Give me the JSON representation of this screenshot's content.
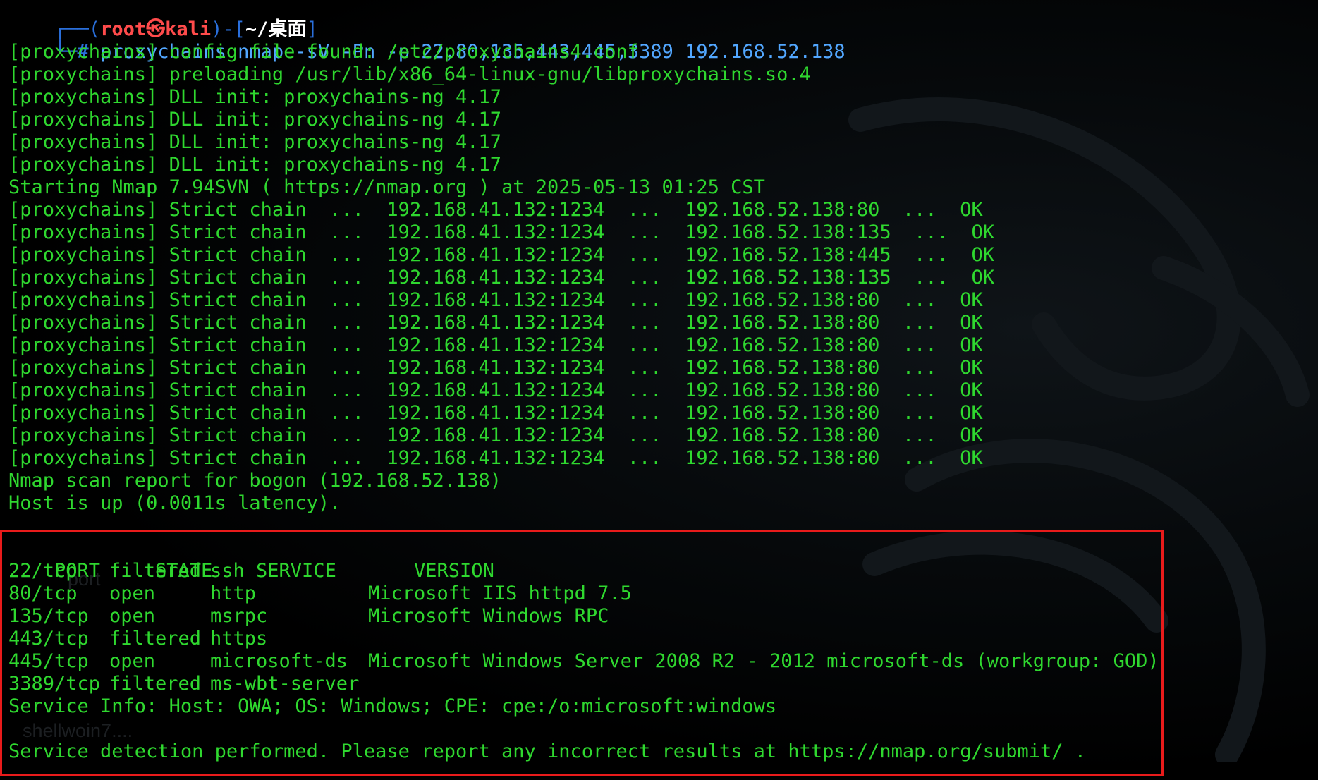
{
  "prompt": {
    "frame_open": "┌──(",
    "user": "root㉿kali",
    "frame_mid": ")-[",
    "dir": "~/桌面",
    "frame_close": "]",
    "hash_prefix": "└─",
    "hash": "#",
    "command": " proxychains nmap -sV -Pn -p 22,80,135,443,445,3389 192.168.52.138"
  },
  "output_lines": [
    "[proxychains] config file found: /etc/proxychains4.conf",
    "[proxychains] preloading /usr/lib/x86_64-linux-gnu/libproxychains.so.4",
    "[proxychains] DLL init: proxychains-ng 4.17",
    "[proxychains] DLL init: proxychains-ng 4.17",
    "[proxychains] DLL init: proxychains-ng 4.17",
    "[proxychains] DLL init: proxychains-ng 4.17",
    "Starting Nmap 7.94SVN ( https://nmap.org ) at 2025-05-13 01:25 CST",
    "[proxychains] Strict chain  ...  192.168.41.132:1234  ...  192.168.52.138:80  ...  OK",
    "[proxychains] Strict chain  ...  192.168.41.132:1234  ...  192.168.52.138:135  ...  OK",
    "[proxychains] Strict chain  ...  192.168.41.132:1234  ...  192.168.52.138:445  ...  OK",
    "[proxychains] Strict chain  ...  192.168.41.132:1234  ...  192.168.52.138:135  ...  OK",
    "[proxychains] Strict chain  ...  192.168.41.132:1234  ...  192.168.52.138:80  ...  OK",
    "[proxychains] Strict chain  ...  192.168.41.132:1234  ...  192.168.52.138:80  ...  OK",
    "[proxychains] Strict chain  ...  192.168.41.132:1234  ...  192.168.52.138:80  ...  OK",
    "[proxychains] Strict chain  ...  192.168.41.132:1234  ...  192.168.52.138:80  ...  OK",
    "[proxychains] Strict chain  ...  192.168.41.132:1234  ...  192.168.52.138:80  ...  OK",
    "[proxychains] Strict chain  ...  192.168.41.132:1234  ...  192.168.52.138:80  ...  OK",
    "[proxychains] Strict chain  ...  192.168.41.132:1234  ...  192.168.52.138:80  ...  OK",
    "[proxychains] Strict chain  ...  192.168.41.132:1234  ...  192.168.52.138:80  ...  OK",
    "Nmap scan report for bogon (192.168.52.138)",
    "Host is up (0.0011s latency)."
  ],
  "port_table": {
    "headers": [
      "PORT",
      "STATE",
      "SERVICE",
      "VERSION"
    ],
    "rows": [
      [
        "22/tcp",
        "filtered",
        "ssh",
        ""
      ],
      [
        "80/tcp",
        "open",
        "http",
        "Microsoft IIS httpd 7.5"
      ],
      [
        "135/tcp",
        "open",
        "msrpc",
        "Microsoft Windows RPC"
      ],
      [
        "443/tcp",
        "filtered",
        "https",
        ""
      ],
      [
        "445/tcp",
        "open",
        "microsoft-ds",
        "Microsoft Windows Server 2008 R2 - 2012 microsoft-ds (workgroup: GOD)"
      ],
      [
        "3389/tcp",
        "filtered",
        "ms-wbt-server",
        ""
      ]
    ]
  },
  "service_info": "Service Info: Host: OWA; OS: Windows; CPE: cpe:/o:microsoft:windows",
  "footer": "Service detection performed. Please report any incorrect results at https://nmap.org/submit/ .",
  "ghost_text": [
    "port",
    "shellwoin7...."
  ],
  "colors": {
    "output_green": "#2fd82f",
    "prompt_red": "#ff4b4b",
    "prompt_blue": "#2a6fdb",
    "command_blue": "#52a7ff",
    "highlight_red": "#e81b1b"
  }
}
